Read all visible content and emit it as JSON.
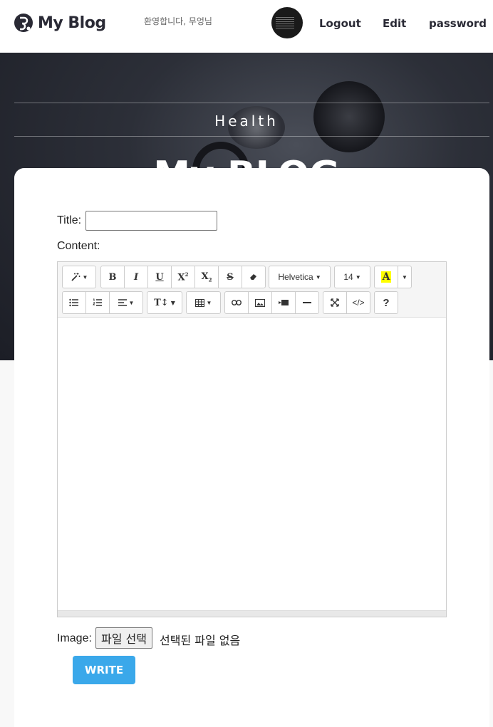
{
  "header": {
    "logo_text": "My Blog",
    "welcome": "환영합니다, 무엉님",
    "nav": {
      "logout": "Logout",
      "edit": "Edit",
      "password": "password"
    }
  },
  "hero": {
    "category": "Health",
    "title": "My BLOG"
  },
  "form": {
    "title_label": "Title:",
    "title_value": "",
    "content_label": "Content:",
    "image_label": "Image:",
    "file_button": "파일 선택",
    "file_status": "선택된 파일 없음",
    "submit": "WRITE"
  },
  "editor": {
    "font_name": "Helvetica",
    "font_size": "14",
    "color_label": "A",
    "toolbar_row1": [
      "magic-icon",
      "bold-icon",
      "italic-icon",
      "underline-icon",
      "superscript-icon",
      "subscript-icon",
      "strikethrough-icon",
      "eraser-icon",
      "font-name",
      "font-size",
      "color",
      "color-dropdown"
    ],
    "toolbar_row2": [
      "unordered-list-icon",
      "ordered-list-icon",
      "align-icon",
      "line-height-icon",
      "table-icon",
      "link-icon",
      "picture-icon",
      "video-icon",
      "hr-icon",
      "fullscreen-icon",
      "code-view-icon",
      "help-icon"
    ],
    "labels": {
      "bold": "B",
      "italic": "I",
      "underline": "U",
      "superscript": "X",
      "subscript": "X",
      "strike": "S",
      "help": "?"
    }
  },
  "colors": {
    "accent": "#3aa8ea",
    "hero_bg": "#1c1e26",
    "header_text": "#2a2a35"
  }
}
